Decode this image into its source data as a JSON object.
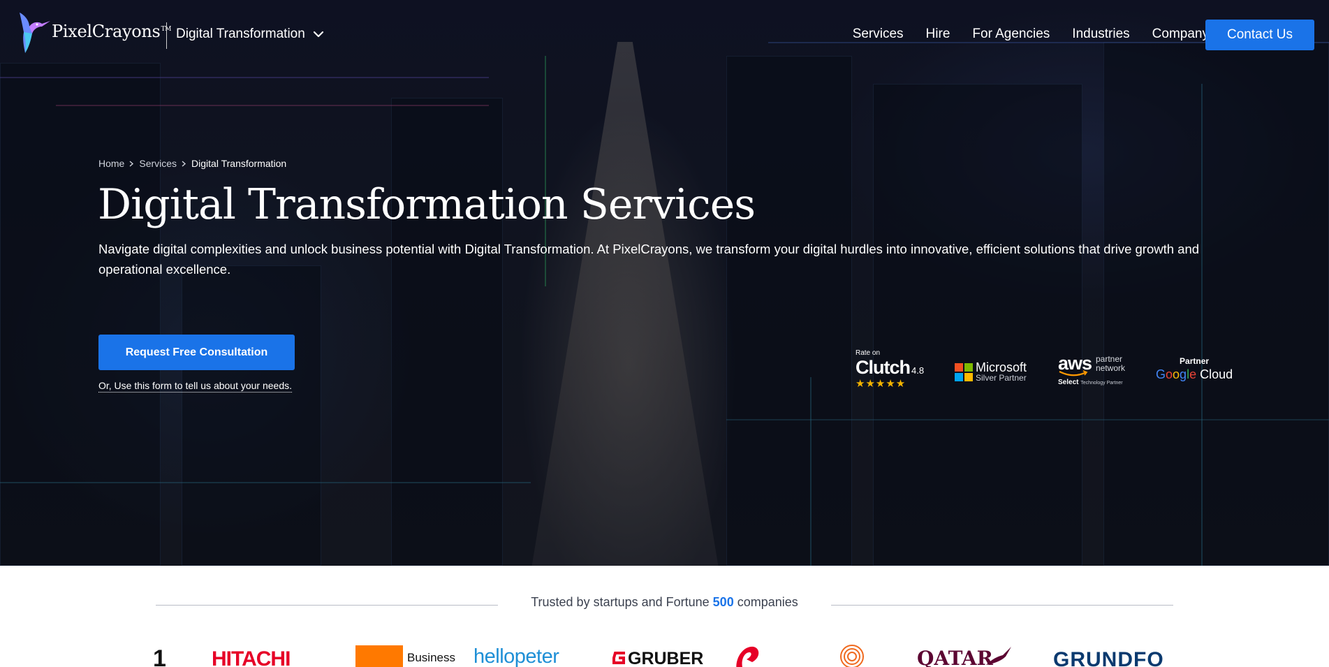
{
  "brand": {
    "name": "PixelCrayons",
    "tm": "TM"
  },
  "page_switch": {
    "label": "Digital Transformation"
  },
  "nav": {
    "items": [
      "Services",
      "Hire",
      "For Agencies",
      "Industries",
      "Company"
    ],
    "cta": "Contact Us"
  },
  "breadcrumb": {
    "home": "Home",
    "services": "Services",
    "current": "Digital Transformation"
  },
  "hero": {
    "title": "Digital Transformation Services",
    "description": "Navigate digital complexities and unlock business potential with Digital Transformation. At PixelCrayons, we transform your digital hurdles into innovative, efficient solutions that drive growth and operational excellence.",
    "cta": "Request Free Consultation",
    "form_link": "Or, Use this form to tell us about your needs."
  },
  "badges": {
    "clutch": {
      "rate_on": "Rate on",
      "name": "Clutch",
      "score": "4.8",
      "stars": "★★★★★"
    },
    "microsoft": {
      "name": "Microsoft",
      "sub": "Silver Partner"
    },
    "aws": {
      "name": "aws",
      "partner": "partner",
      "network": "network",
      "select": "Select",
      "tech": "Technology Partner"
    },
    "google": {
      "partner": "Partner",
      "g": "G",
      "o1": "o",
      "o2": "o",
      "g2": "g",
      "l": "l",
      "e": "e",
      "cloud": " Cloud"
    }
  },
  "trusted": {
    "prefix": "Trusted by startups and Fortune ",
    "number": "500",
    "suffix": " companies"
  },
  "client_logos": [
    "1",
    "HITACHI",
    "Business",
    "hellopeter",
    "GRUBER",
    "QATAR",
    "GRUNDFO"
  ],
  "colors": {
    "accent": "#1a73e8",
    "hitachi": "#e60027",
    "orange": "#ff7900",
    "qatar": "#5c0632",
    "grundfos": "#0b3a6f"
  }
}
